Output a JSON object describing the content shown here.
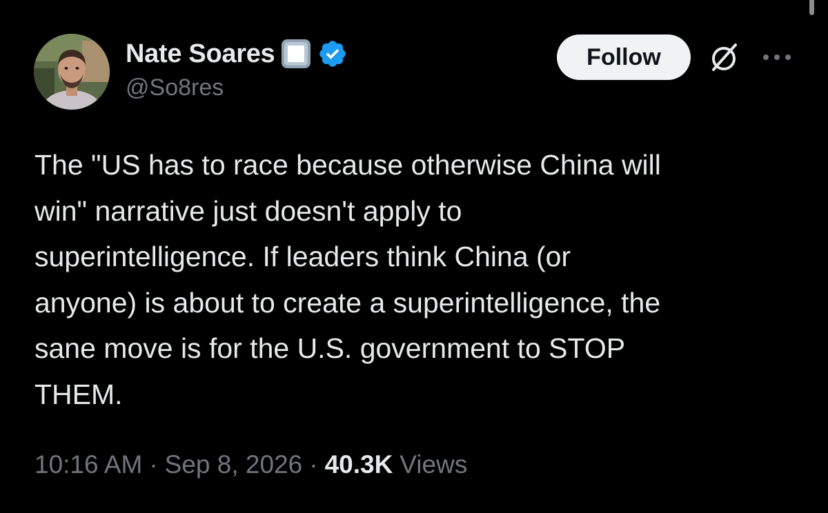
{
  "author": {
    "display_name": "Nate Soares",
    "handle": "@So8res",
    "avatar_icon": "person-photo-icon",
    "badges": [
      "square-emoji-icon",
      "verified-badge-icon"
    ],
    "verified_color": "#1d9bf0"
  },
  "actions": {
    "follow_label": "Follow",
    "grok_icon": "grok-icon",
    "more_icon": "more-options-icon"
  },
  "tweet": {
    "text": "The \"US has to race because otherwise China will\nwin\" narrative just doesn't apply to\nsuperintelligence. If leaders think China (or\nanyone) is about to create a superintelligence, the\nsane move is for the U.S. government to STOP\nTHEM."
  },
  "meta": {
    "time": "10:16 AM",
    "separator": "·",
    "date": "Sep 8, 2026",
    "views_count": "40.3K",
    "views_label": "Views"
  },
  "colors": {
    "background": "#000000",
    "primary_text": "#e7e9ea",
    "secondary_text": "#71767b",
    "follow_button_bg": "#eff3f4"
  }
}
